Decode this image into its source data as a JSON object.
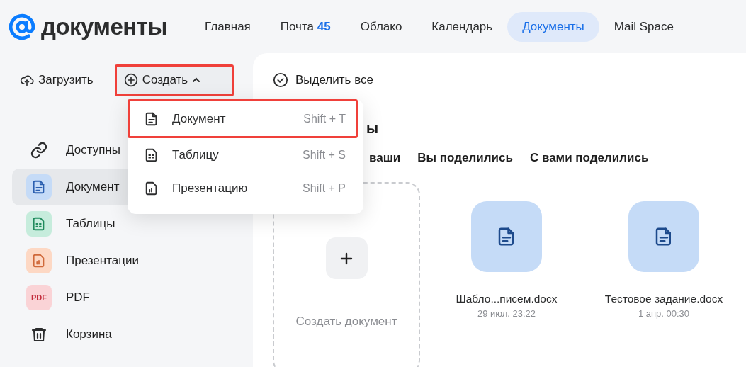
{
  "header": {
    "logo_text": "документы",
    "nav": [
      {
        "label": "Главная",
        "selected": false
      },
      {
        "label": "Почта",
        "badge": "45",
        "selected": false
      },
      {
        "label": "Облако",
        "selected": false
      },
      {
        "label": "Календарь",
        "selected": false
      },
      {
        "label": "Документы",
        "selected": true
      },
      {
        "label": "Mail Space",
        "selected": false
      }
    ]
  },
  "toolbar": {
    "upload": "Загрузить",
    "create": {
      "label": "Создать",
      "expanded": true,
      "highlighted": true
    }
  },
  "sidebar": {
    "items": [
      {
        "kind": "link",
        "label": "Доступны",
        "selected": false
      },
      {
        "kind": "doc",
        "label": "Документ",
        "selected": true
      },
      {
        "kind": "sheet",
        "label": "Таблицы",
        "selected": false
      },
      {
        "kind": "slides",
        "label": "Презентации",
        "selected": false
      },
      {
        "kind": "pdf",
        "label": "PDF",
        "selected": false,
        "badge": "PDF"
      },
      {
        "kind": "trash",
        "label": "Корзина",
        "selected": false
      }
    ]
  },
  "main": {
    "select_all": "Выделить все",
    "heading_fragment": "ы",
    "filter_tabs": [
      "ваши",
      "Вы поделились",
      "С вами поделились"
    ],
    "create_card": {
      "label": "Создать документ"
    },
    "files": [
      {
        "name": "Шабло...писем.docx",
        "date": "29 июл. 23:22"
      },
      {
        "name": "Тестовое задание.docx",
        "date": "1 апр. 00:30"
      }
    ]
  },
  "create_menu": {
    "items": [
      {
        "kind": "doc",
        "label": "Документ",
        "shortcut": "Shift + T",
        "highlighted": true
      },
      {
        "kind": "sheet",
        "label": "Таблицу",
        "shortcut": "Shift + S",
        "highlighted": false
      },
      {
        "kind": "slides",
        "label": "Презентацию",
        "shortcut": "Shift + P",
        "highlighted": false
      }
    ]
  }
}
